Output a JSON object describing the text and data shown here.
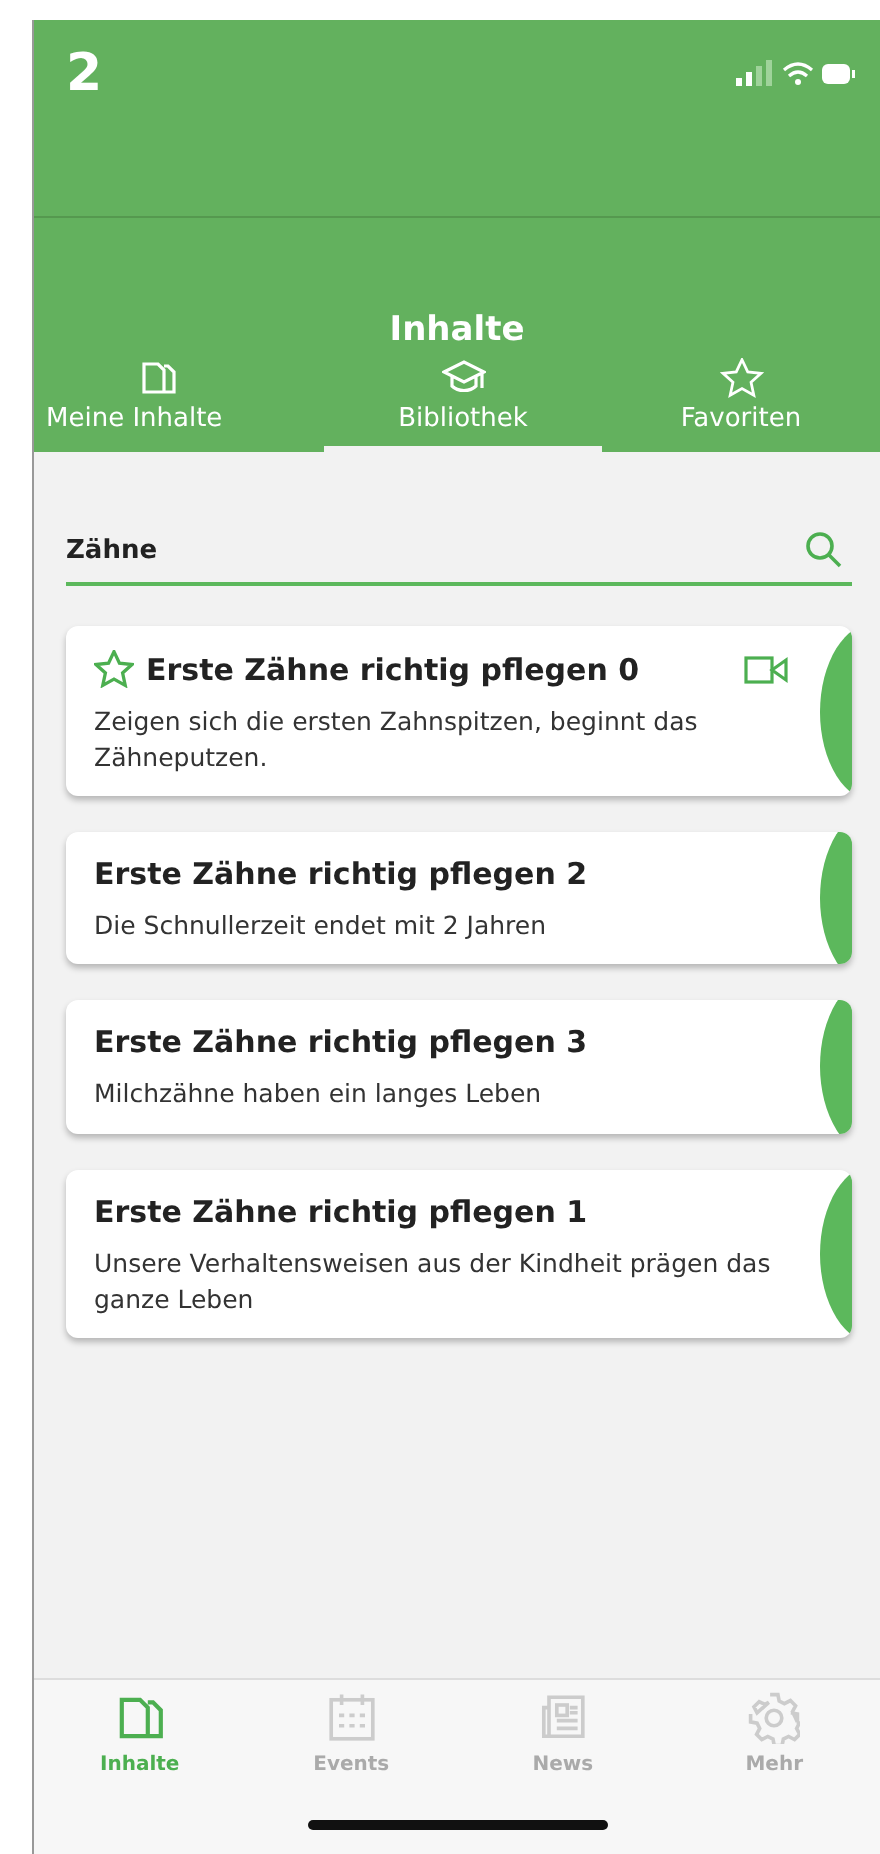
{
  "figure_label": "2",
  "header": {
    "title": "Inhalte"
  },
  "tabs": [
    {
      "label": "Meine Inhalte",
      "selected": false
    },
    {
      "label": "Bibliothek",
      "selected": true
    },
    {
      "label": "Favoriten",
      "selected": false
    }
  ],
  "search": {
    "value": "Zähne"
  },
  "cards": [
    {
      "title": "Erste Zähne richtig pflegen 0",
      "description": "Zeigen sich die ersten Zahnspitzen, beginnt das Zähneputzen.",
      "favorite": true,
      "video": true
    },
    {
      "title": "Erste Zähne richtig pflegen 2",
      "description": "Die Schnullerzeit endet mit 2 Jahren",
      "favorite": false,
      "video": false
    },
    {
      "title": "Erste Zähne richtig pflegen 3",
      "description": "Milchzähne haben ein langes Leben",
      "favorite": false,
      "video": false
    },
    {
      "title": "Erste Zähne richtig pflegen 1",
      "description": "Unsere Verhaltensweisen aus der Kindheit prägen das ganze Leben",
      "favorite": false,
      "video": false
    }
  ],
  "bottom_nav": [
    {
      "label": "Inhalte",
      "selected": true
    },
    {
      "label": "Events",
      "selected": false
    },
    {
      "label": "News",
      "selected": false
    },
    {
      "label": "Mehr",
      "selected": false
    }
  ]
}
